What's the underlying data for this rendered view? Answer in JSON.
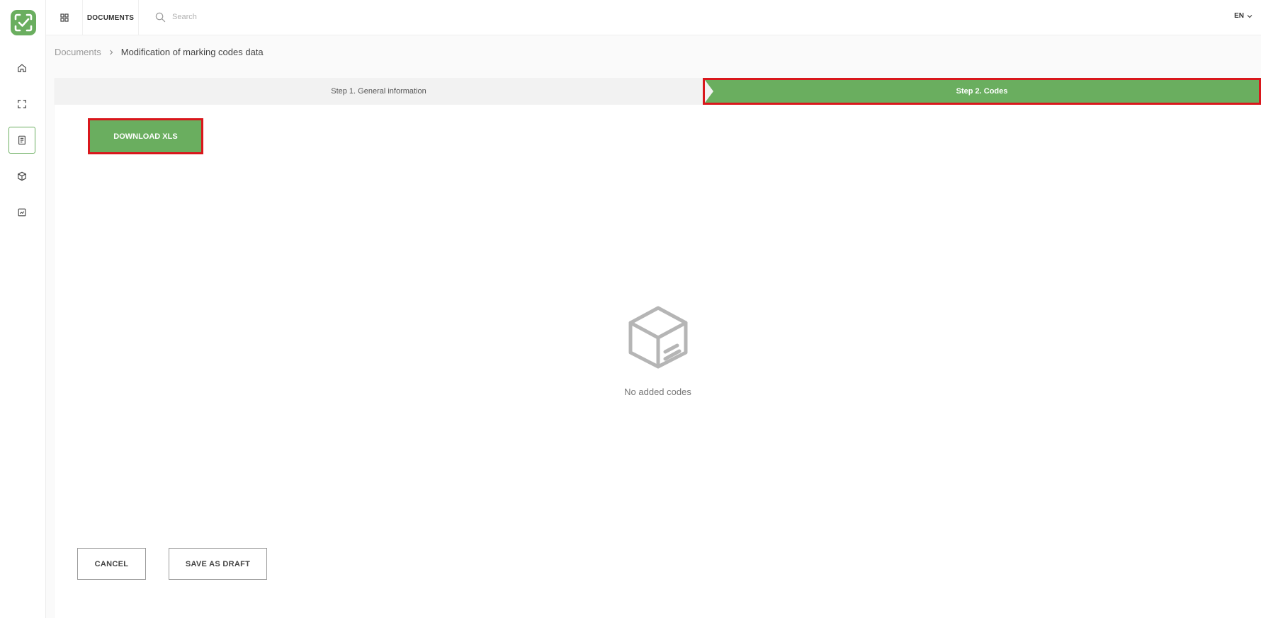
{
  "app": {
    "logo_icon": "check-scan-logo-icon",
    "accent_color": "#6aae5f",
    "highlight_color": "#d9171c"
  },
  "sidebar": {
    "items": [
      {
        "icon": "home-icon",
        "active": false
      },
      {
        "icon": "scan-frame-icon",
        "active": false
      },
      {
        "icon": "document-icon",
        "active": true
      },
      {
        "icon": "box-icon",
        "active": false
      },
      {
        "icon": "report-icon",
        "active": false
      }
    ]
  },
  "topbar": {
    "section_label": "DOCUMENTS",
    "search_placeholder": "Search",
    "search_value": "",
    "language": "EN"
  },
  "breadcrumb": {
    "parent": "Documents",
    "current": "Modification of marking codes data"
  },
  "steps": [
    {
      "label": "Step 1. General information",
      "active": false
    },
    {
      "label": "Step 2. Codes",
      "active": true
    }
  ],
  "main": {
    "download_label": "DOWNLOAD XLS",
    "empty_state_icon": "empty-box-icon",
    "empty_state_text": "No added codes"
  },
  "actions": {
    "cancel_label": "CANCEL",
    "draft_label": "SAVE AS DRAFT"
  }
}
